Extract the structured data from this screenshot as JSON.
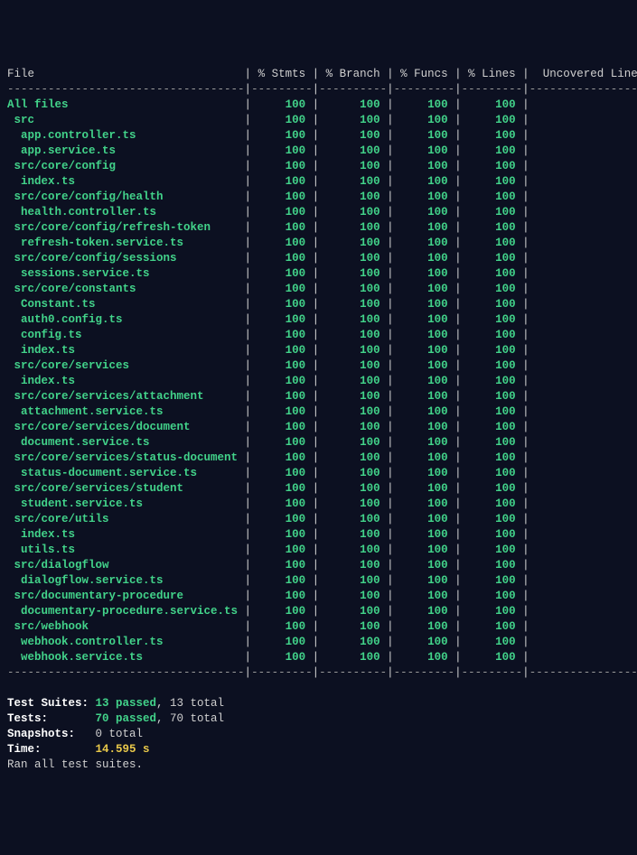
{
  "columns": [
    "File",
    "% Stmts",
    "% Branch",
    "% Funcs",
    "% Lines",
    "Uncovered Line #s"
  ],
  "rows": [
    {
      "file": "All files",
      "indent": 0,
      "stmts": "100",
      "branch": "100",
      "funcs": "100",
      "lines": "100",
      "unc": ""
    },
    {
      "file": "src",
      "indent": 1,
      "stmts": "100",
      "branch": "100",
      "funcs": "100",
      "lines": "100",
      "unc": ""
    },
    {
      "file": "app.controller.ts",
      "indent": 2,
      "stmts": "100",
      "branch": "100",
      "funcs": "100",
      "lines": "100",
      "unc": ""
    },
    {
      "file": "app.service.ts",
      "indent": 2,
      "stmts": "100",
      "branch": "100",
      "funcs": "100",
      "lines": "100",
      "unc": ""
    },
    {
      "file": "src/core/config",
      "indent": 1,
      "stmts": "100",
      "branch": "100",
      "funcs": "100",
      "lines": "100",
      "unc": ""
    },
    {
      "file": "index.ts",
      "indent": 2,
      "stmts": "100",
      "branch": "100",
      "funcs": "100",
      "lines": "100",
      "unc": ""
    },
    {
      "file": "src/core/config/health",
      "indent": 1,
      "stmts": "100",
      "branch": "100",
      "funcs": "100",
      "lines": "100",
      "unc": ""
    },
    {
      "file": "health.controller.ts",
      "indent": 2,
      "stmts": "100",
      "branch": "100",
      "funcs": "100",
      "lines": "100",
      "unc": ""
    },
    {
      "file": "src/core/config/refresh-token",
      "indent": 1,
      "stmts": "100",
      "branch": "100",
      "funcs": "100",
      "lines": "100",
      "unc": ""
    },
    {
      "file": "refresh-token.service.ts",
      "indent": 2,
      "stmts": "100",
      "branch": "100",
      "funcs": "100",
      "lines": "100",
      "unc": ""
    },
    {
      "file": "src/core/config/sessions",
      "indent": 1,
      "stmts": "100",
      "branch": "100",
      "funcs": "100",
      "lines": "100",
      "unc": ""
    },
    {
      "file": "sessions.service.ts",
      "indent": 2,
      "stmts": "100",
      "branch": "100",
      "funcs": "100",
      "lines": "100",
      "unc": ""
    },
    {
      "file": "src/core/constants",
      "indent": 1,
      "stmts": "100",
      "branch": "100",
      "funcs": "100",
      "lines": "100",
      "unc": ""
    },
    {
      "file": "Constant.ts",
      "indent": 2,
      "stmts": "100",
      "branch": "100",
      "funcs": "100",
      "lines": "100",
      "unc": ""
    },
    {
      "file": "auth0.config.ts",
      "indent": 2,
      "stmts": "100",
      "branch": "100",
      "funcs": "100",
      "lines": "100",
      "unc": ""
    },
    {
      "file": "config.ts",
      "indent": 2,
      "stmts": "100",
      "branch": "100",
      "funcs": "100",
      "lines": "100",
      "unc": ""
    },
    {
      "file": "index.ts",
      "indent": 2,
      "stmts": "100",
      "branch": "100",
      "funcs": "100",
      "lines": "100",
      "unc": ""
    },
    {
      "file": "src/core/services",
      "indent": 1,
      "stmts": "100",
      "branch": "100",
      "funcs": "100",
      "lines": "100",
      "unc": ""
    },
    {
      "file": "index.ts",
      "indent": 2,
      "stmts": "100",
      "branch": "100",
      "funcs": "100",
      "lines": "100",
      "unc": ""
    },
    {
      "file": "src/core/services/attachment",
      "indent": 1,
      "stmts": "100",
      "branch": "100",
      "funcs": "100",
      "lines": "100",
      "unc": ""
    },
    {
      "file": "attachment.service.ts",
      "indent": 2,
      "stmts": "100",
      "branch": "100",
      "funcs": "100",
      "lines": "100",
      "unc": ""
    },
    {
      "file": "src/core/services/document",
      "indent": 1,
      "stmts": "100",
      "branch": "100",
      "funcs": "100",
      "lines": "100",
      "unc": ""
    },
    {
      "file": "document.service.ts",
      "indent": 2,
      "stmts": "100",
      "branch": "100",
      "funcs": "100",
      "lines": "100",
      "unc": ""
    },
    {
      "file": "src/core/services/status-document",
      "indent": 1,
      "stmts": "100",
      "branch": "100",
      "funcs": "100",
      "lines": "100",
      "unc": ""
    },
    {
      "file": "status-document.service.ts",
      "indent": 2,
      "stmts": "100",
      "branch": "100",
      "funcs": "100",
      "lines": "100",
      "unc": ""
    },
    {
      "file": "src/core/services/student",
      "indent": 1,
      "stmts": "100",
      "branch": "100",
      "funcs": "100",
      "lines": "100",
      "unc": ""
    },
    {
      "file": "student.service.ts",
      "indent": 2,
      "stmts": "100",
      "branch": "100",
      "funcs": "100",
      "lines": "100",
      "unc": ""
    },
    {
      "file": "src/core/utils",
      "indent": 1,
      "stmts": "100",
      "branch": "100",
      "funcs": "100",
      "lines": "100",
      "unc": ""
    },
    {
      "file": "index.ts",
      "indent": 2,
      "stmts": "100",
      "branch": "100",
      "funcs": "100",
      "lines": "100",
      "unc": ""
    },
    {
      "file": "utils.ts",
      "indent": 2,
      "stmts": "100",
      "branch": "100",
      "funcs": "100",
      "lines": "100",
      "unc": ""
    },
    {
      "file": "src/dialogflow",
      "indent": 1,
      "stmts": "100",
      "branch": "100",
      "funcs": "100",
      "lines": "100",
      "unc": ""
    },
    {
      "file": "dialogflow.service.ts",
      "indent": 2,
      "stmts": "100",
      "branch": "100",
      "funcs": "100",
      "lines": "100",
      "unc": ""
    },
    {
      "file": "src/documentary-procedure",
      "indent": 1,
      "stmts": "100",
      "branch": "100",
      "funcs": "100",
      "lines": "100",
      "unc": ""
    },
    {
      "file": "documentary-procedure.service.ts",
      "indent": 2,
      "stmts": "100",
      "branch": "100",
      "funcs": "100",
      "lines": "100",
      "unc": ""
    },
    {
      "file": "src/webhook",
      "indent": 1,
      "stmts": "100",
      "branch": "100",
      "funcs": "100",
      "lines": "100",
      "unc": ""
    },
    {
      "file": "webhook.controller.ts",
      "indent": 2,
      "stmts": "100",
      "branch": "100",
      "funcs": "100",
      "lines": "100",
      "unc": ""
    },
    {
      "file": "webhook.service.ts",
      "indent": 2,
      "stmts": "100",
      "branch": "100",
      "funcs": "100",
      "lines": "100",
      "unc": ""
    }
  ],
  "widths": {
    "file": 35,
    "stmts": 9,
    "branch": 10,
    "funcs": 9,
    "lines": 9,
    "unc": 20
  },
  "summary": {
    "test_suites_label": "Test Suites:",
    "test_suites_passed": "13 passed",
    "test_suites_total": ", 13 total",
    "tests_label": "Tests:",
    "tests_passed": "70 passed",
    "tests_total": ", 70 total",
    "snapshots_label": "Snapshots:",
    "snapshots_value": "0 total",
    "time_label": "Time:",
    "time_value": "14.595 s",
    "ran": "Ran all test suites."
  }
}
